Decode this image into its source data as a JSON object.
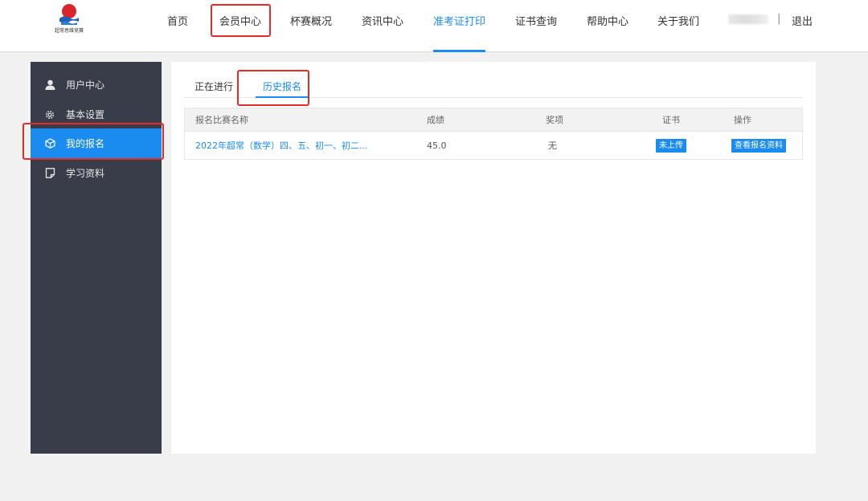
{
  "header": {
    "logo_text": "超常思维竞赛",
    "nav": [
      {
        "label": "首页"
      },
      {
        "label": "会员中心"
      },
      {
        "label": "杯赛概况"
      },
      {
        "label": "资讯中心"
      },
      {
        "label": "准考证打印"
      },
      {
        "label": "证书查询"
      },
      {
        "label": "帮助中心"
      },
      {
        "label": "关于我们"
      }
    ],
    "separator": "|",
    "logout": "退出"
  },
  "sidebar": {
    "items": [
      {
        "label": "用户中心",
        "icon": "user-icon"
      },
      {
        "label": "基本设置",
        "icon": "gear-icon"
      },
      {
        "label": "我的报名",
        "icon": "box-icon"
      },
      {
        "label": "学习资料",
        "icon": "document-icon"
      }
    ]
  },
  "main": {
    "tabs": [
      {
        "label": "正在进行"
      },
      {
        "label": "历史报名"
      }
    ],
    "table": {
      "headers": [
        "报名比赛名称",
        "成绩",
        "奖项",
        "证书",
        "操作"
      ],
      "rows": [
        {
          "name": "2022年超常（数学）四、五、初一、初二...",
          "score": "45.0",
          "award": "无",
          "certificate": "未上传",
          "action": "查看报名资料"
        }
      ]
    }
  },
  "colors": {
    "accent": "#1a8cf0",
    "sidebar_bg": "#393d49",
    "highlight": "#e52a2a"
  }
}
